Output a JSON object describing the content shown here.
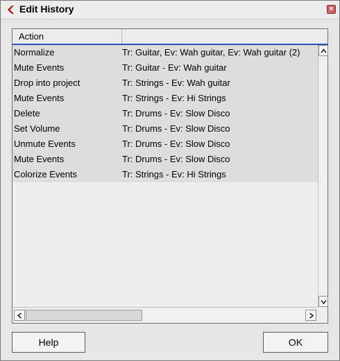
{
  "window": {
    "title": "Edit History",
    "close_icon": "close-icon",
    "logo_icon": "cubase-logo-icon"
  },
  "columns": [
    "Action",
    ""
  ],
  "rows": [
    {
      "action": "Normalize",
      "detail": "Tr: Guitar, Ev: Wah guitar, Ev: Wah guitar (2)"
    },
    {
      "action": "Mute Events",
      "detail": "Tr: Guitar - Ev: Wah guitar"
    },
    {
      "action": "Drop into project",
      "detail": "Tr: Strings - Ev: Wah guitar"
    },
    {
      "action": "Mute Events",
      "detail": "Tr: Strings - Ev: Hi Strings"
    },
    {
      "action": "Delete",
      "detail": "Tr: Drums - Ev: Slow Disco"
    },
    {
      "action": "Set Volume",
      "detail": "Tr: Drums - Ev: Slow Disco"
    },
    {
      "action": "Unmute Events",
      "detail": "Tr: Drums - Ev: Slow Disco"
    },
    {
      "action": "Mute Events",
      "detail": "Tr: Drums - Ev: Slow Disco"
    },
    {
      "action": "Colorize Events",
      "detail": "Tr: Strings - Ev: Hi Strings"
    }
  ],
  "buttons": {
    "help_label": "Help",
    "ok_label": "OK"
  },
  "colors": {
    "header_underline": "#2f4fb8",
    "logo": "#b8171b",
    "row_bg": "#dddddd",
    "list_bg": "#eeeeee"
  }
}
